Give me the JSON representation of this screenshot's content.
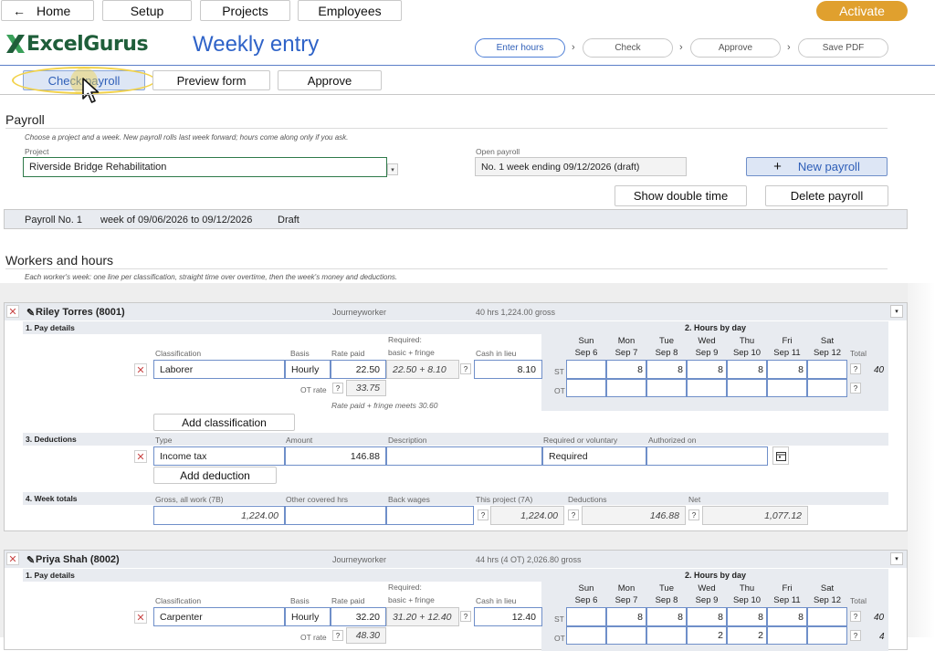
{
  "toolbar": {
    "back_icon": "←",
    "home": "Home",
    "setup": "Setup",
    "projects": "Projects",
    "employees": "Employees",
    "activate": "Activate",
    "accent": "#e0a02e"
  },
  "header": {
    "brand": "ExcelGurus",
    "title": "Weekly entry",
    "steps": [
      "Enter hours",
      "Check",
      "Approve",
      "Save PDF"
    ],
    "step_sep": "›"
  },
  "subnav": {
    "check": "Check payroll",
    "preview": "Preview form",
    "approve": "Approve"
  },
  "payroll": {
    "section": "Payroll",
    "hint": "Choose a project and a week. New payroll rolls last week forward; hours come along only if you ask.",
    "project_label": "Project",
    "project_value": "Riverside Bridge Rehabilitation",
    "open_label": "Open payroll",
    "open_value": "No. 1   week ending 09/12/2026   (draft)",
    "new_payroll": "New payroll",
    "new_icon": "+",
    "show_double": "Show double time",
    "delete": "Delete payroll",
    "summary_no": "Payroll No. 1",
    "summary_week": "week of 09/06/2026 to 09/12/2026",
    "summary_status": "Draft"
  },
  "workers_section": {
    "title": "Workers and hours",
    "hint": "Each worker's week: one line per classification, straight time over overtime, then the week's money and deductions."
  },
  "labels": {
    "pay_details": "1. Pay details",
    "hours_by_day": "2. Hours by day",
    "classification": "Classification",
    "basis": "Basis",
    "rate_paid": "Rate paid",
    "required": "Required:",
    "basic_fringe": "basic + fringe",
    "cash_lieu": "Cash in lieu",
    "total": "Total",
    "st": "ST",
    "ot": "OT",
    "ot_rate": "OT rate",
    "q": "?",
    "x": "✕",
    "add_class": "Add classification",
    "deductions": "3. Deductions",
    "type": "Type",
    "amount": "Amount",
    "description": "Description",
    "req_vol": "Required or voluntary",
    "authorized": "Authorized on",
    "add_deduction": "Add deduction",
    "week_totals": "4. Week totals",
    "gross_all": "Gross, all work (7B)",
    "other_hrs": "Other covered hrs",
    "back_wages": "Back wages",
    "this_project": "This project (7A)",
    "deductions_col": "Deductions",
    "net": "Net",
    "days": [
      {
        "d": "Sun",
        "date": "Sep 6"
      },
      {
        "d": "Mon",
        "date": "Sep 7"
      },
      {
        "d": "Tue",
        "date": "Sep 8"
      },
      {
        "d": "Wed",
        "date": "Sep 9"
      },
      {
        "d": "Thu",
        "date": "Sep 10"
      },
      {
        "d": "Fri",
        "date": "Sep 11"
      },
      {
        "d": "Sat",
        "date": "Sep 12"
      }
    ]
  },
  "workers": [
    {
      "name": "Riley Torres (8001)",
      "role": "Journeyworker",
      "summary": "40 hrs   1,224.00 gross",
      "classification": "Laborer",
      "basis": "Hourly",
      "rate_paid": "22.50",
      "required": "22.50 + 8.10",
      "cash_lieu": "8.10",
      "ot_rate": "33.75",
      "rate_note": "Rate paid + fringe meets 30.60",
      "st_hours": [
        "",
        "8",
        "8",
        "8",
        "8",
        "8",
        ""
      ],
      "st_total": "40",
      "ot_hours": [
        "",
        "",
        "",
        "",
        "",
        "",
        ""
      ],
      "ot_total": "",
      "deduction_type": "Income tax",
      "deduction_amount": "146.88",
      "deduction_desc": "",
      "deduction_req": "Required",
      "deduction_auth": "",
      "gross_all": "1,224.00",
      "this_project": "1,224.00",
      "deductions_total": "146.88",
      "net": "1,077.12"
    },
    {
      "name": "Priya Shah (8002)",
      "role": "Journeyworker",
      "summary": "44 hrs (4 OT)   2,026.80 gross",
      "classification": "Carpenter",
      "basis": "Hourly",
      "rate_paid": "32.20",
      "required": "31.20 + 12.40",
      "cash_lieu": "12.40",
      "ot_rate": "48.30",
      "st_hours": [
        "",
        "8",
        "8",
        "8",
        "8",
        "8",
        ""
      ],
      "st_total": "40",
      "ot_hours": [
        "",
        "",
        "",
        "2",
        "2",
        "",
        ""
      ],
      "ot_total": "4"
    }
  ]
}
